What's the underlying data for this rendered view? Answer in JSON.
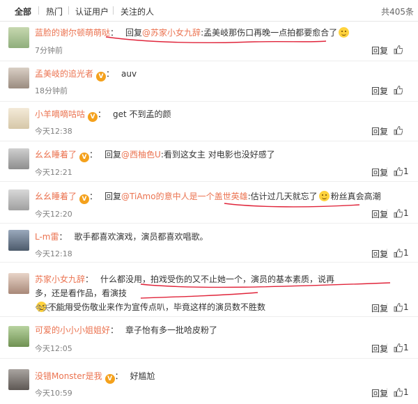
{
  "tabs": [
    {
      "label": "全部",
      "active": true
    },
    {
      "label": "热门",
      "active": false
    },
    {
      "label": "认证用户",
      "active": false
    },
    {
      "label": "关注的人",
      "active": false
    }
  ],
  "total": "共405条",
  "reply_label": "回复",
  "comments": [
    {
      "user": "蓝脸的谢尔顿萌萌哒",
      "reply_prefix": "回复",
      "reply_to": "@苏家小女九辞",
      "text": ":孟美岐那伤口再晚一点拍都要愈合了",
      "time": "7分钟前",
      "likes": ""
    },
    {
      "user": "孟美岐的追光者",
      "text": "auv",
      "time": "18分钟前",
      "likes": ""
    },
    {
      "user": "小羊嘀嘀咕咕",
      "text": "get 不到孟的颜",
      "time": "今天12:38",
      "likes": ""
    },
    {
      "user": "幺幺睡着了",
      "reply_prefix": "回复",
      "reply_to": "@西柚色U",
      "text": ":看到这女主 对电影也没好感了",
      "time": "今天12:21",
      "likes": "1"
    },
    {
      "user": "幺幺睡着了",
      "reply_prefix": "回复",
      "reply_to": "@TiAmo的意中人是一个盖世英雄",
      "text": ":估计过几天就忘了",
      "text_tail": "粉丝真会高潮",
      "time": "今天12:20",
      "likes": "1"
    },
    {
      "user": "L-m雷",
      "text": "歌手都喜欢演戏，演员都喜欢唱歌。",
      "time": "今天12:18",
      "likes": "1"
    },
    {
      "user": "苏家小女九辞",
      "text": "什么都没用，拍戏受伤的又不止她一个，演员的基本素质，说再多，还是看作品，看演技",
      "text_line2": "不能用受伤敬业来作为宣传点叭，毕竟这样的演员数不胜数",
      "time": "今天12:08",
      "likes": "1"
    },
    {
      "user": "可爱的小小小姐姐好",
      "text": "章子怡有多一批哈皮粉了",
      "time": "今天12:05",
      "likes": "1"
    },
    {
      "user": "没错Monster是我",
      "text": "好尴尬",
      "time": "今天10:59",
      "likes": "1"
    }
  ],
  "colors": {
    "username": "#eb7350",
    "text": "#333333",
    "time": "#808080",
    "annotation": "#e0243a"
  }
}
